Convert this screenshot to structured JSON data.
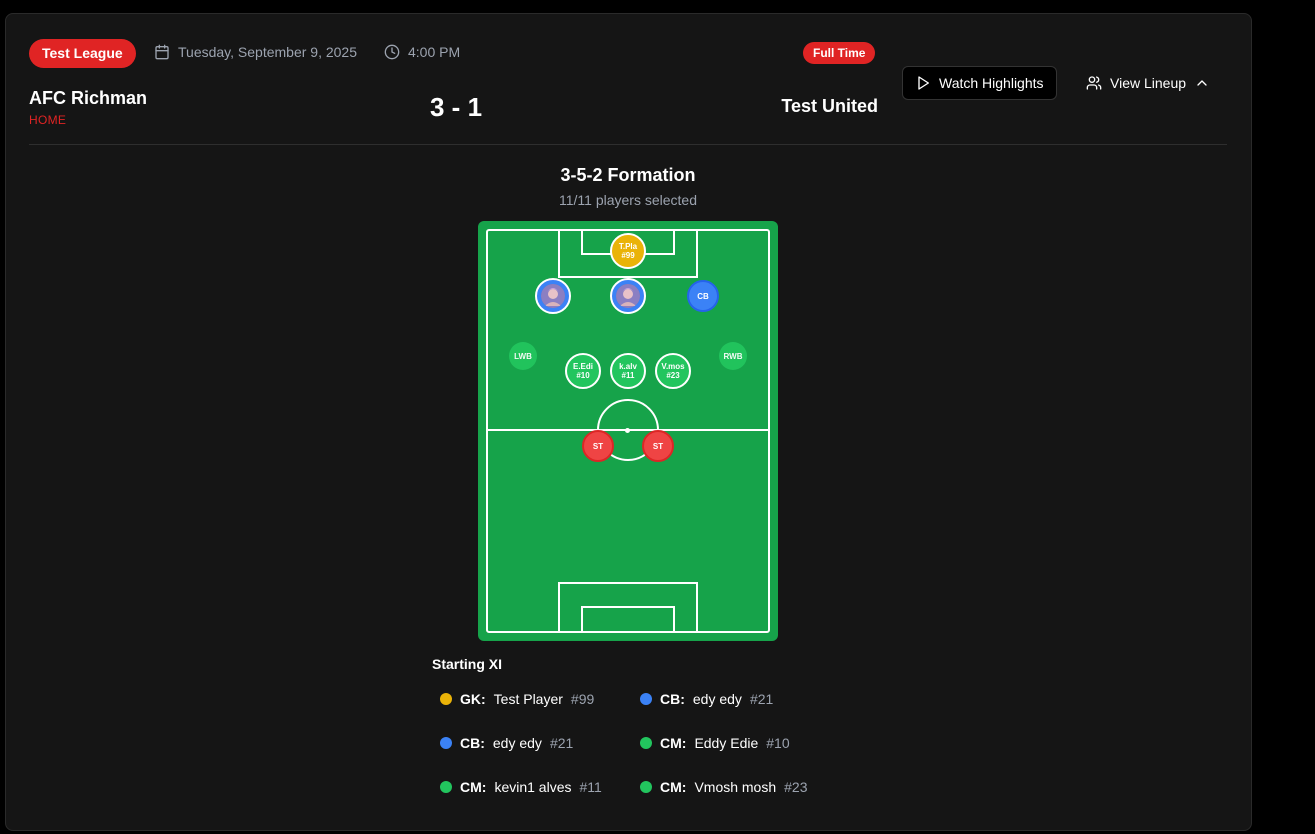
{
  "match": {
    "league": "Test League",
    "date": "Tuesday, September 9, 2025",
    "time": "4:00 PM",
    "status": "Full Time",
    "home_team": "AFC Richman",
    "home_label": "HOME",
    "score": "3 - 1",
    "away_team": "Test United"
  },
  "actions": {
    "highlights_label": "Watch Highlights",
    "lineup_label": "View Lineup"
  },
  "formation": {
    "title": "3-5-2 Formation",
    "subtitle": "11/11 players selected"
  },
  "pitch": {
    "gk": {
      "name": "T.Pla",
      "num": "#99"
    },
    "cb3": "CB",
    "lwb": "LWB",
    "rwb": "RWB",
    "cm1": {
      "name": "E.Edi",
      "num": "#10"
    },
    "cm2": {
      "name": "k.alv",
      "num": "#11"
    },
    "cm3": {
      "name": "V.mos",
      "num": "#23"
    },
    "st1": "ST",
    "st2": "ST"
  },
  "starting_xi": {
    "title": "Starting XI",
    "players": [
      {
        "pos": "GK:",
        "name": "Test Player",
        "num": "#99",
        "color": "#eab308"
      },
      {
        "pos": "CB:",
        "name": "edy edy",
        "num": "#21",
        "color": "#3b82f6"
      },
      {
        "pos": "CB:",
        "name": "edy edy",
        "num": "#21",
        "color": "#3b82f6"
      },
      {
        "pos": "CM:",
        "name": "Eddy Edie",
        "num": "#10",
        "color": "#22c55e"
      },
      {
        "pos": "CM:",
        "name": "kevin1 alves",
        "num": "#11",
        "color": "#22c55e"
      },
      {
        "pos": "CM:",
        "name": "Vmosh mosh",
        "num": "#23",
        "color": "#22c55e"
      }
    ]
  },
  "colors": {
    "accent": "#e02424",
    "pitch": "#16a34a",
    "gk": "#eab308",
    "cb": "#3b82f6",
    "cm": "#22c55e",
    "st": "#ef4444"
  }
}
